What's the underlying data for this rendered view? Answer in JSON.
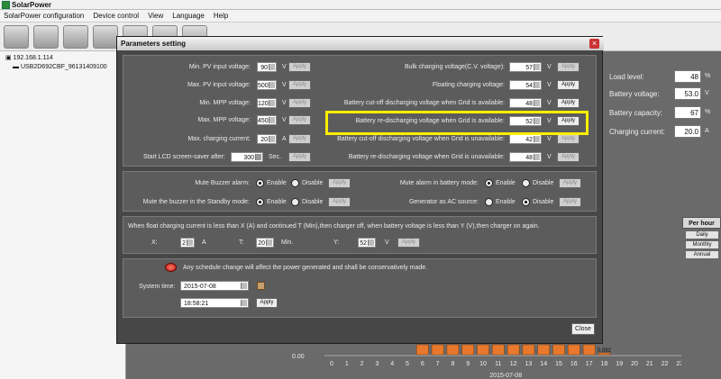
{
  "app": {
    "title": "SolarPower"
  },
  "menu": [
    "SolarPower configuration",
    "Device control",
    "View",
    "Language",
    "Help"
  ],
  "tree": {
    "ip": "192.168.1.114",
    "device": "USB2D692CBF_96131409100"
  },
  "right_panel": [
    {
      "label": "Load level:",
      "value": "48",
      "unit": "%"
    },
    {
      "label": "Battery voltage:",
      "value": "53.0",
      "unit": "V"
    },
    {
      "label": "Battery capacity:",
      "value": "67",
      "unit": "%"
    },
    {
      "label": "Charging current:",
      "value": "20.0",
      "unit": "A"
    }
  ],
  "period": {
    "header": "Per hour",
    "buttons": [
      "Daily",
      "Monthly",
      "Annual"
    ]
  },
  "chart_data": {
    "type": "bar",
    "categories": [
      "0",
      "1",
      "2",
      "3",
      "4",
      "5",
      "6",
      "7",
      "8",
      "9",
      "10",
      "11",
      "12",
      "13",
      "14",
      "15",
      "16",
      "17",
      "18",
      "19",
      "20",
      "21",
      "22",
      "23"
    ],
    "values": [
      0,
      0,
      0,
      0,
      0,
      0,
      1,
      1,
      1,
      1,
      1,
      1,
      1,
      1,
      1,
      1,
      1,
      1,
      0.092,
      0,
      0,
      0,
      0,
      0
    ],
    "xlabel": "2015-07-08",
    "y_tick": "0.00",
    "labels": {
      "top_partial": "0.092"
    }
  },
  "modal": {
    "title": "Parameters setting",
    "close_label": "Close",
    "apply": "Apply",
    "unit_v": "V",
    "unit_a": "A",
    "unit_sec": "Sec.",
    "left_rows": [
      {
        "label": "Min. PV input voltage:",
        "value": "90",
        "unit": "V"
      },
      {
        "label": "Max. PV input voltage:",
        "value": "500",
        "unit": "V"
      },
      {
        "label": "Min. MPP voltage:",
        "value": "120",
        "unit": "V"
      },
      {
        "label": "Max. MPP voltage:",
        "value": "450",
        "unit": "V"
      },
      {
        "label": "Max. charging current:",
        "value": "20",
        "unit": "A"
      },
      {
        "label": "Start LCD screen-saver after:",
        "value": "300",
        "unit": "Sec."
      }
    ],
    "right_rows": [
      {
        "label": "Bulk charging voltage(C.V. voltage):",
        "value": "57",
        "unit": "V"
      },
      {
        "label": "Floating charging voltage:",
        "value": "54",
        "unit": "V"
      },
      {
        "label": "Battery cut-off discharging voltage when Grid is available:",
        "value": "48",
        "unit": "V"
      },
      {
        "label": "Battery re-discharging voltage when Grid is available:",
        "value": "52",
        "unit": "V"
      },
      {
        "label": "Battery cut-off discharging voltage when Grid is unavailable:",
        "value": "42",
        "unit": "V"
      },
      {
        "label": "Battery re-discharging voltage when Grid is unavailable:",
        "value": "48",
        "unit": "V"
      }
    ],
    "options": [
      {
        "label": "Mute Buzzer alarm:"
      },
      {
        "label": "Mute the buzzer in the Standby mode:"
      },
      {
        "label": "Mute alarm in battery mode:"
      },
      {
        "label": "Generator as AC source:"
      }
    ],
    "enable": "Enable",
    "disable": "Disable",
    "float_text": "When float charging current is less than X (A) and continued T (Min),then charger off, when battery voltage is less than Y (V),then charger on again.",
    "x_label": "X:",
    "x_value": "2",
    "x_unit": "A",
    "t_label": "T:",
    "t_value": "20",
    "t_unit": "Min.",
    "y_label": "Y:",
    "y_value": "52",
    "y_unit": "V",
    "warning": "Any schedule change will affect the power generated and shall be conservatively made.",
    "system_time_label": "System time:",
    "date": "2015-07-08",
    "time": "18:58:21"
  }
}
